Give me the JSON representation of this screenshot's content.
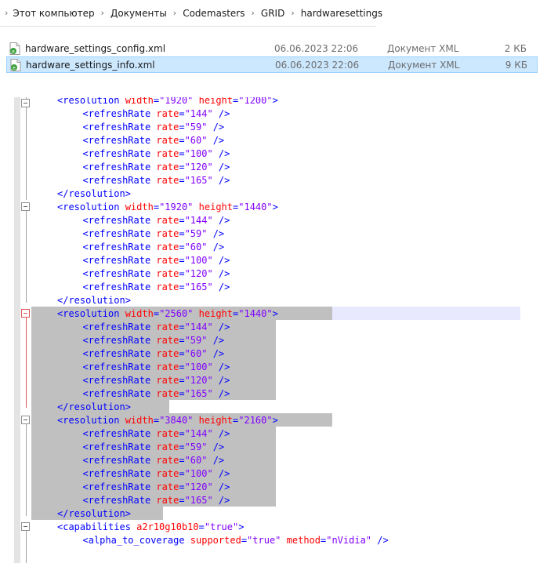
{
  "breadcrumb": [
    "Этот компьютер",
    "Документы",
    "Codemasters",
    "GRID",
    "hardwaresettings"
  ],
  "files": [
    {
      "name": "hardware_settings_config.xml",
      "date": "06.06.2023 22:06",
      "type": "Документ XML",
      "size": "2 КБ",
      "selected": false
    },
    {
      "name": "hardware_settings_info.xml",
      "date": "06.06.2023 22:06",
      "type": "Документ XML",
      "size": "9 КБ",
      "selected": true
    }
  ],
  "colors": {
    "tag": "#0000ff",
    "attr": "#ff0000",
    "value": "#8000ff",
    "selection": "#c0c0c0",
    "fold_active": "#e05555"
  },
  "code": [
    {
      "indent": 2,
      "parts": [
        [
          "t",
          "<resolution "
        ],
        [
          "a",
          "width"
        ],
        [
          "t",
          "="
        ],
        [
          "v",
          "\"1920\""
        ],
        [
          "t",
          " "
        ],
        [
          "a",
          "height"
        ],
        [
          "t",
          "="
        ],
        [
          "v",
          "\"1200\""
        ],
        [
          "t",
          ">"
        ]
      ]
    },
    {
      "indent": 3,
      "parts": [
        [
          "t",
          "<refreshRate "
        ],
        [
          "a",
          "rate"
        ],
        [
          "t",
          "="
        ],
        [
          "v",
          "\"144\""
        ],
        [
          "t",
          " />"
        ]
      ]
    },
    {
      "indent": 3,
      "parts": [
        [
          "t",
          "<refreshRate "
        ],
        [
          "a",
          "rate"
        ],
        [
          "t",
          "="
        ],
        [
          "v",
          "\"59\""
        ],
        [
          "t",
          " />"
        ]
      ]
    },
    {
      "indent": 3,
      "parts": [
        [
          "t",
          "<refreshRate "
        ],
        [
          "a",
          "rate"
        ],
        [
          "t",
          "="
        ],
        [
          "v",
          "\"60\""
        ],
        [
          "t",
          " />"
        ]
      ]
    },
    {
      "indent": 3,
      "parts": [
        [
          "t",
          "<refreshRate "
        ],
        [
          "a",
          "rate"
        ],
        [
          "t",
          "="
        ],
        [
          "v",
          "\"100\""
        ],
        [
          "t",
          " />"
        ]
      ]
    },
    {
      "indent": 3,
      "parts": [
        [
          "t",
          "<refreshRate "
        ],
        [
          "a",
          "rate"
        ],
        [
          "t",
          "="
        ],
        [
          "v",
          "\"120\""
        ],
        [
          "t",
          " />"
        ]
      ]
    },
    {
      "indent": 3,
      "parts": [
        [
          "t",
          "<refreshRate "
        ],
        [
          "a",
          "rate"
        ],
        [
          "t",
          "="
        ],
        [
          "v",
          "\"165\""
        ],
        [
          "t",
          " />"
        ]
      ]
    },
    {
      "indent": 2,
      "parts": [
        [
          "t",
          "</resolution>"
        ]
      ]
    },
    {
      "indent": 2,
      "parts": [
        [
          "t",
          "<resolution "
        ],
        [
          "a",
          "width"
        ],
        [
          "t",
          "="
        ],
        [
          "v",
          "\"1920\""
        ],
        [
          "t",
          " "
        ],
        [
          "a",
          "height"
        ],
        [
          "t",
          "="
        ],
        [
          "v",
          "\"1440\""
        ],
        [
          "t",
          ">"
        ]
      ]
    },
    {
      "indent": 3,
      "parts": [
        [
          "t",
          "<refreshRate "
        ],
        [
          "a",
          "rate"
        ],
        [
          "t",
          "="
        ],
        [
          "v",
          "\"144\""
        ],
        [
          "t",
          " />"
        ]
      ]
    },
    {
      "indent": 3,
      "parts": [
        [
          "t",
          "<refreshRate "
        ],
        [
          "a",
          "rate"
        ],
        [
          "t",
          "="
        ],
        [
          "v",
          "\"59\""
        ],
        [
          "t",
          " />"
        ]
      ]
    },
    {
      "indent": 3,
      "parts": [
        [
          "t",
          "<refreshRate "
        ],
        [
          "a",
          "rate"
        ],
        [
          "t",
          "="
        ],
        [
          "v",
          "\"60\""
        ],
        [
          "t",
          " />"
        ]
      ]
    },
    {
      "indent": 3,
      "parts": [
        [
          "t",
          "<refreshRate "
        ],
        [
          "a",
          "rate"
        ],
        [
          "t",
          "="
        ],
        [
          "v",
          "\"100\""
        ],
        [
          "t",
          " />"
        ]
      ]
    },
    {
      "indent": 3,
      "parts": [
        [
          "t",
          "<refreshRate "
        ],
        [
          "a",
          "rate"
        ],
        [
          "t",
          "="
        ],
        [
          "v",
          "\"120\""
        ],
        [
          "t",
          " />"
        ]
      ]
    },
    {
      "indent": 3,
      "parts": [
        [
          "t",
          "<refreshRate "
        ],
        [
          "a",
          "rate"
        ],
        [
          "t",
          "="
        ],
        [
          "v",
          "\"165\""
        ],
        [
          "t",
          " />"
        ]
      ]
    },
    {
      "indent": 2,
      "parts": [
        [
          "t",
          "</resolution>"
        ]
      ]
    },
    {
      "indent": 2,
      "parts": [
        [
          "t",
          "<resolution "
        ],
        [
          "a",
          "width"
        ],
        [
          "t",
          "="
        ],
        [
          "v",
          "\"2560\""
        ],
        [
          "t",
          " "
        ],
        [
          "a",
          "height"
        ],
        [
          "t",
          "="
        ],
        [
          "v",
          "\"1440\""
        ],
        [
          "t",
          ">"
        ]
      ]
    },
    {
      "indent": 3,
      "parts": [
        [
          "t",
          "<refreshRate "
        ],
        [
          "a",
          "rate"
        ],
        [
          "t",
          "="
        ],
        [
          "v",
          "\"144\""
        ],
        [
          "t",
          " />"
        ]
      ]
    },
    {
      "indent": 3,
      "parts": [
        [
          "t",
          "<refreshRate "
        ],
        [
          "a",
          "rate"
        ],
        [
          "t",
          "="
        ],
        [
          "v",
          "\"59\""
        ],
        [
          "t",
          " />"
        ]
      ]
    },
    {
      "indent": 3,
      "parts": [
        [
          "t",
          "<refreshRate "
        ],
        [
          "a",
          "rate"
        ],
        [
          "t",
          "="
        ],
        [
          "v",
          "\"60\""
        ],
        [
          "t",
          " />"
        ]
      ]
    },
    {
      "indent": 3,
      "parts": [
        [
          "t",
          "<refreshRate "
        ],
        [
          "a",
          "rate"
        ],
        [
          "t",
          "="
        ],
        [
          "v",
          "\"100\""
        ],
        [
          "t",
          " />"
        ]
      ]
    },
    {
      "indent": 3,
      "parts": [
        [
          "t",
          "<refreshRate "
        ],
        [
          "a",
          "rate"
        ],
        [
          "t",
          "="
        ],
        [
          "v",
          "\"120\""
        ],
        [
          "t",
          " />"
        ]
      ]
    },
    {
      "indent": 3,
      "parts": [
        [
          "t",
          "<refreshRate "
        ],
        [
          "a",
          "rate"
        ],
        [
          "t",
          "="
        ],
        [
          "v",
          "\"165\""
        ],
        [
          "t",
          " />"
        ]
      ]
    },
    {
      "indent": 2,
      "parts": [
        [
          "t",
          "</resolution>"
        ]
      ]
    },
    {
      "indent": 2,
      "parts": [
        [
          "t",
          "<resolution "
        ],
        [
          "a",
          "width"
        ],
        [
          "t",
          "="
        ],
        [
          "v",
          "\"3840\""
        ],
        [
          "t",
          " "
        ],
        [
          "a",
          "height"
        ],
        [
          "t",
          "="
        ],
        [
          "v",
          "\"2160\""
        ],
        [
          "t",
          ">"
        ]
      ]
    },
    {
      "indent": 3,
      "parts": [
        [
          "t",
          "<refreshRate "
        ],
        [
          "a",
          "rate"
        ],
        [
          "t",
          "="
        ],
        [
          "v",
          "\"144\""
        ],
        [
          "t",
          " />"
        ]
      ]
    },
    {
      "indent": 3,
      "parts": [
        [
          "t",
          "<refreshRate "
        ],
        [
          "a",
          "rate"
        ],
        [
          "t",
          "="
        ],
        [
          "v",
          "\"59\""
        ],
        [
          "t",
          " />"
        ]
      ]
    },
    {
      "indent": 3,
      "parts": [
        [
          "t",
          "<refreshRate "
        ],
        [
          "a",
          "rate"
        ],
        [
          "t",
          "="
        ],
        [
          "v",
          "\"60\""
        ],
        [
          "t",
          " />"
        ]
      ]
    },
    {
      "indent": 3,
      "parts": [
        [
          "t",
          "<refreshRate "
        ],
        [
          "a",
          "rate"
        ],
        [
          "t",
          "="
        ],
        [
          "v",
          "\"100\""
        ],
        [
          "t",
          " />"
        ]
      ]
    },
    {
      "indent": 3,
      "parts": [
        [
          "t",
          "<refreshRate "
        ],
        [
          "a",
          "rate"
        ],
        [
          "t",
          "="
        ],
        [
          "v",
          "\"120\""
        ],
        [
          "t",
          " />"
        ]
      ]
    },
    {
      "indent": 3,
      "parts": [
        [
          "t",
          "<refreshRate "
        ],
        [
          "a",
          "rate"
        ],
        [
          "t",
          "="
        ],
        [
          "v",
          "\"165\""
        ],
        [
          "t",
          " />"
        ]
      ]
    },
    {
      "indent": 2,
      "parts": [
        [
          "t",
          "</resolution>"
        ]
      ]
    },
    {
      "indent": 2,
      "parts": [
        [
          "t",
          "<capabilities "
        ],
        [
          "a",
          "a2r10g10b10"
        ],
        [
          "t",
          "="
        ],
        [
          "v",
          "\"true\""
        ],
        [
          "t",
          ">"
        ]
      ]
    },
    {
      "indent": 3,
      "parts": [
        [
          "t",
          "<alpha_to_coverage "
        ],
        [
          "a",
          "supported"
        ],
        [
          "t",
          "="
        ],
        [
          "v",
          "\"true\""
        ],
        [
          "t",
          " "
        ],
        [
          "a",
          "method"
        ],
        [
          "t",
          "="
        ],
        [
          "v",
          "\"nVidia\""
        ],
        [
          "t",
          " />"
        ]
      ]
    }
  ]
}
